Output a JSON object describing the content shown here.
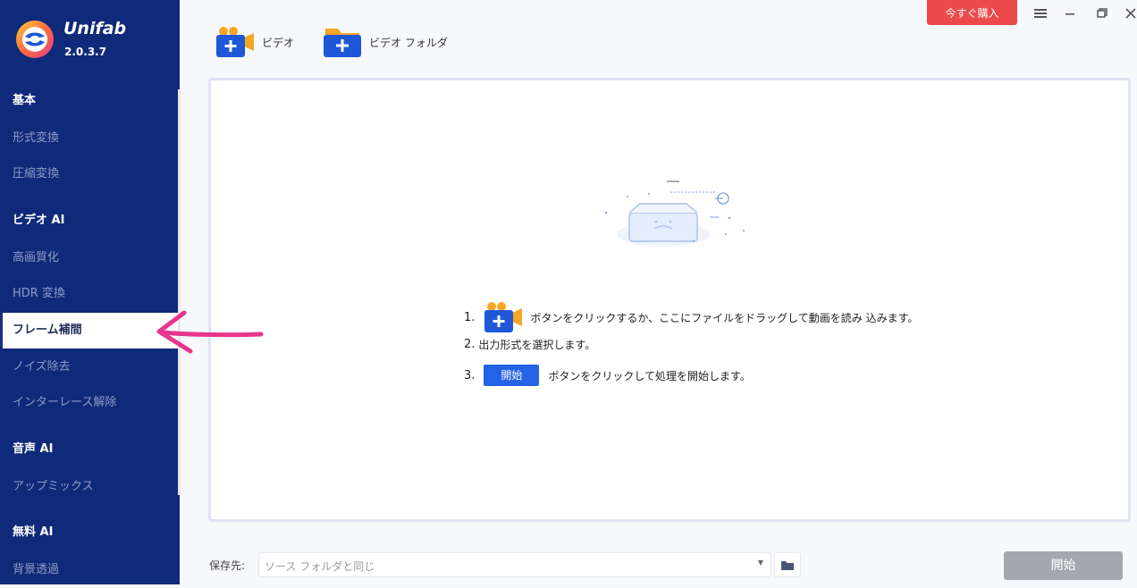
{
  "app": {
    "name": "Unifab",
    "version": "2.0.3.7"
  },
  "sidebar": {
    "sections": [
      {
        "title": "基本",
        "items": [
          "形式変換",
          "圧縮変換"
        ]
      },
      {
        "title": "ビデオ AI",
        "items": [
          "高画質化",
          "HDR 変換",
          "フレーム補間",
          "ノイズ除去",
          "インターレース解除"
        ]
      },
      {
        "title": "音声 AI",
        "items": [
          "アップミックス"
        ]
      },
      {
        "title": "無料 AI",
        "items": [
          "背景透過"
        ]
      }
    ],
    "active_item": "フレーム補間"
  },
  "toolbar": {
    "add_video_label": "ビデオ",
    "add_folder_label": "ビデオ フォルダ",
    "buy_label": "今すぐ購入"
  },
  "drop_area": {
    "steps": [
      {
        "num": "1.",
        "text": "ボタンをクリックするか、ここにファイルをドラッグして動画を読み 込みます。"
      },
      {
        "num": "2.",
        "text": "出力形式を選択します。"
      },
      {
        "num": "3.",
        "button_label": "開始",
        "text": "ボタンをクリックして処理を開始します。"
      }
    ]
  },
  "footer": {
    "save_label": "保存先:",
    "save_value": "ソース フォルダと同じ",
    "start_label": "開始"
  },
  "colors": {
    "sidebar_bg": "#102a7a",
    "accent_blue": "#2563e6",
    "buy_red": "#ec4a4a",
    "start_disabled": "#a4a7ad",
    "arrow_pink": "#e8368f"
  }
}
